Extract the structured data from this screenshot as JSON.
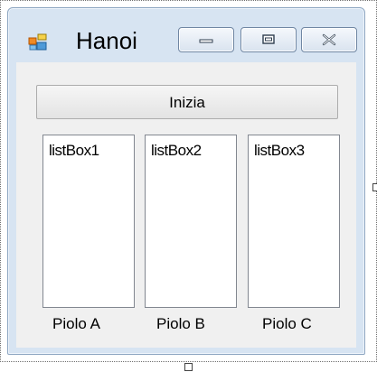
{
  "window": {
    "title": "Hanoi"
  },
  "icons": {
    "app": "windows-form-icon",
    "minimize": "minimize-icon",
    "maximize": "maximize-icon",
    "close": "close-icon"
  },
  "controls": {
    "start_button": "Inizia",
    "listboxes": [
      {
        "item": "listBox1"
      },
      {
        "item": "listBox2"
      },
      {
        "item": "listBox3"
      }
    ],
    "labels": [
      "Piolo A",
      "Piolo B",
      "Piolo C"
    ]
  }
}
